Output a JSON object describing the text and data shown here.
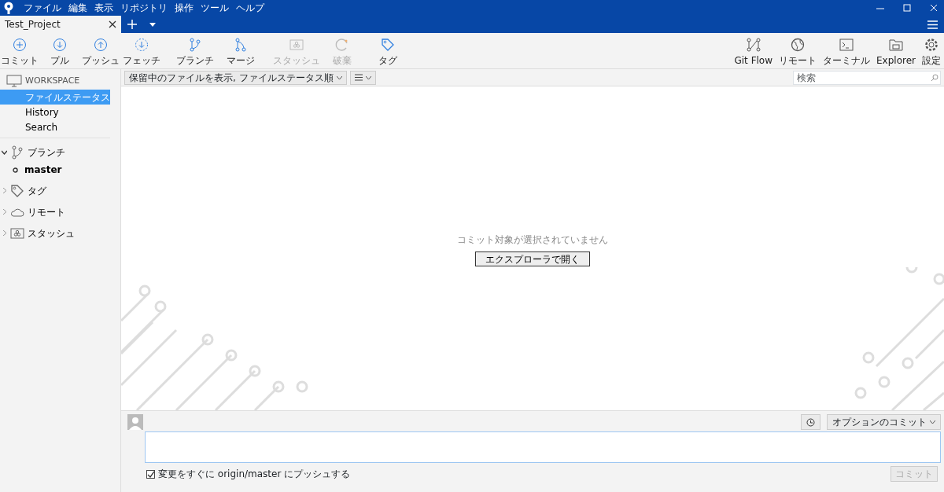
{
  "menu": [
    "ファイル",
    "編集",
    "表示",
    "リポジトリ",
    "操作",
    "ツール",
    "ヘルプ"
  ],
  "tabs": [
    {
      "label": "Test_Project",
      "selected": true
    }
  ],
  "toolbar_left": [
    {
      "label": "コミット",
      "disabled": false
    },
    {
      "label": "プル",
      "disabled": false
    },
    {
      "label": "プッシュ",
      "disabled": false
    },
    {
      "label": "フェッチ",
      "disabled": false
    },
    {
      "label": "ブランチ",
      "disabled": false
    },
    {
      "label": "マージ",
      "disabled": false
    },
    {
      "label": "スタッシュ",
      "disabled": true
    },
    {
      "label": "破棄",
      "disabled": true
    },
    {
      "label": "タグ",
      "disabled": false
    }
  ],
  "toolbar_right": [
    {
      "label": "Git Flow"
    },
    {
      "label": "リモート"
    },
    {
      "label": "ターミナル"
    },
    {
      "label": "Explorer"
    },
    {
      "label": "設定"
    }
  ],
  "sidebar": {
    "workspace": {
      "label": "WORKSPACE",
      "items": [
        {
          "label": "ファイルステータス",
          "selected": true
        },
        {
          "label": "History",
          "selected": false
        },
        {
          "label": "Search",
          "selected": false
        }
      ]
    },
    "groups": [
      {
        "label": "ブランチ",
        "expanded": true,
        "children": [
          {
            "label": "master"
          }
        ]
      },
      {
        "label": "タグ",
        "expanded": false
      },
      {
        "label": "リモート",
        "expanded": false
      },
      {
        "label": "スタッシュ",
        "expanded": false
      }
    ]
  },
  "filter": {
    "dropdown": "保留中のファイルを表示, ファイルステータス順"
  },
  "search": {
    "placeholder": "検索"
  },
  "empty": {
    "message": "コミット対象が選択されていません",
    "button": "エクスプローラで開く"
  },
  "commit": {
    "options": "オプションのコミット",
    "push_label": "変更をすぐに origin/master にプッシュする",
    "push_checked": true,
    "button": "コミット"
  }
}
